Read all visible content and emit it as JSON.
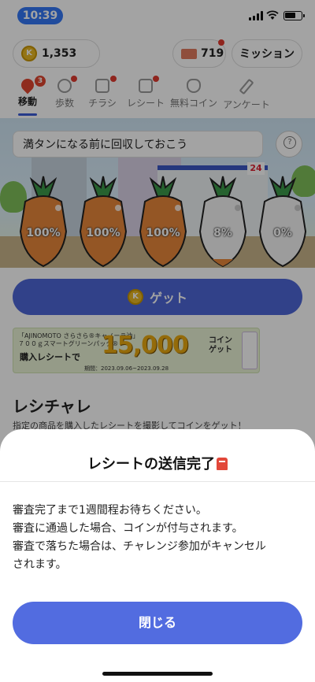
{
  "status_bar": {
    "time": "10:39"
  },
  "header": {
    "coin_balance": "1,353",
    "ticket_count": "719",
    "mission_label": "ミッション"
  },
  "tabs": [
    {
      "label": "移動",
      "active": true,
      "badge": "3",
      "icon": "location-pin-icon"
    },
    {
      "label": "歩数",
      "active": false,
      "icon": "footprints-icon"
    },
    {
      "label": "チラシ",
      "active": false,
      "icon": "flyer-icon"
    },
    {
      "label": "レシート",
      "active": false,
      "icon": "receipt-icon"
    },
    {
      "label": "無料コイン",
      "active": false,
      "icon": "coin-bag-icon"
    },
    {
      "label": "アンケート",
      "active": false,
      "icon": "pencil-icon"
    }
  ],
  "scene": {
    "hint_text": "満タンになる前に回収しておこう",
    "store_number": "24",
    "carrots": [
      {
        "label": "100%",
        "fill": 1.0
      },
      {
        "label": "100%",
        "fill": 1.0
      },
      {
        "label": "100%",
        "fill": 1.0
      },
      {
        "label": "8%",
        "fill": 0.08
      },
      {
        "label": "0%",
        "fill": 0.0
      }
    ]
  },
  "get_button_label": "ゲット",
  "banner": {
    "brand_line": "「AJINOMOTO さらさら®キャノーラ油」",
    "product_line": "７００ｇスマートグリーンパック®",
    "buy_text": "購入レシートで",
    "amount": "15,000",
    "coin_word": "コイン",
    "get_word": "ゲット",
    "period": "期間：2023.09.06~2023.09.28"
  },
  "section": {
    "title": "レシチャレ",
    "description": "指定の商品を購入したレシートを撮影してコインをゲット！"
  },
  "modal": {
    "title": "レシートの送信完了",
    "lines": [
      "審査完了まで1週間程お待ちください。",
      "審査に通過した場合、コインが付与されます。",
      "審査で落ちた場合は、チャレンジ参加がキャンセル",
      "されます。"
    ],
    "close_label": "閉じる"
  },
  "colors": {
    "accent": "#526ce0",
    "badge_red": "#e0462f",
    "carrot_orange": "#e8873a",
    "carrot_leaf": "#3c9a4a",
    "status_pill": "#3478f6"
  }
}
